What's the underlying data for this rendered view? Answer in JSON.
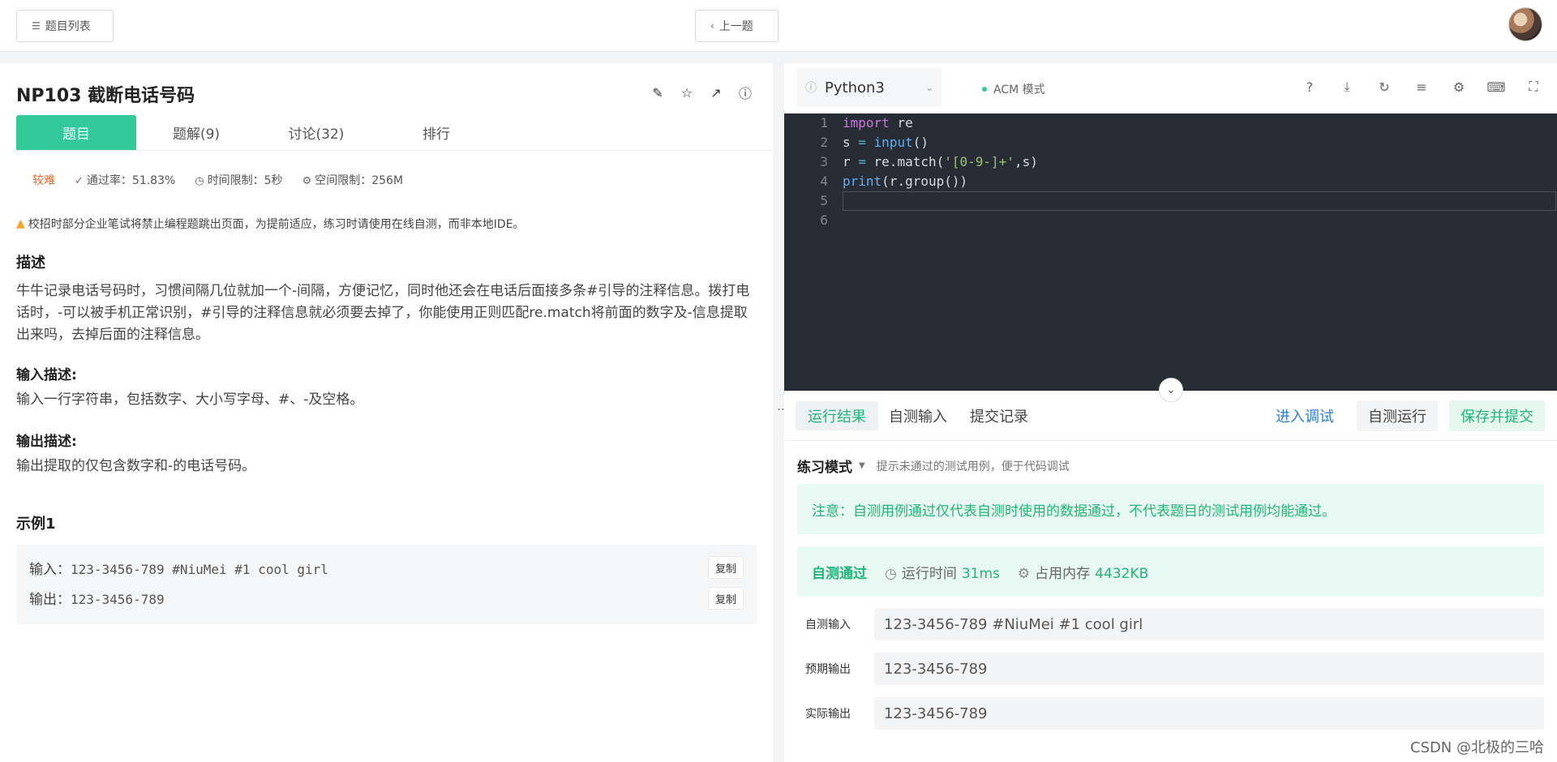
{
  "topbar": {
    "problem_list_label": "题目列表",
    "prev_label": "上一题"
  },
  "problem": {
    "title": "NP103  截断电话号码",
    "tabs": [
      "题目",
      "题解(9)",
      "讨论(32)",
      "排行"
    ],
    "difficulty": "较难",
    "pass_rate": "通过率：51.83%",
    "time_limit": "时间限制：5秒",
    "space_limit": "空间限制：256M",
    "warning": "校招时部分企业笔试将禁止编程题跳出页面，为提前适应，练习时请使用在线自测，而非本地IDE。",
    "desc_heading": "描述",
    "desc_text": "牛牛记录电话号码时，习惯间隔几位就加一个-间隔，方便记忆，同时他还会在电话后面接多条#引导的注释信息。拨打电话时，-可以被手机正常识别，#引导的注释信息就必须要去掉了，你能使用正则匹配re.match将前面的数字及-信息提取出来吗，去掉后面的注释信息。",
    "input_heading": "输入描述:",
    "input_text": "输入一行字符串，包括数字、大小写字母、#、-及空格。",
    "output_heading": "输出描述:",
    "output_text": "输出提取的仅包含数字和-的电话号码。",
    "example_heading": "示例1",
    "example": {
      "input_label": "输入：",
      "input_value": "123-3456-789 #NiuMei #1 cool girl",
      "output_label": "输出：",
      "output_value": "123-3456-789",
      "copy_label": "复制"
    }
  },
  "editor": {
    "language": "Python3",
    "mode": "ACM 模式",
    "line_numbers": [
      "1",
      "2",
      "3",
      "4",
      "5",
      "6"
    ]
  },
  "results": {
    "tabs": [
      "运行结果",
      "自测输入",
      "提交记录"
    ],
    "debug_label": "进入调试",
    "run_label": "自测运行",
    "submit_label": "保存并提交",
    "mode_title": "练习模式",
    "mode_hint": "提示未通过的测试用例，便于代码调试",
    "notice": "注意：自测用例通过仅代表自测时使用的数据通过，不代表题目的测试用例均能通过。",
    "status": "自测通过",
    "runtime_label": "运行时间",
    "runtime_value": "31ms",
    "memory_label": "占用内存",
    "memory_value": "4432KB",
    "rows": [
      {
        "label": "自测输入",
        "value": "123-3456-789 #NiuMei #1 cool girl"
      },
      {
        "label": "预期输出",
        "value": "123-3456-789"
      },
      {
        "label": "实际输出",
        "value": "123-3456-789"
      }
    ]
  },
  "watermark": "CSDN @北极的三哈"
}
